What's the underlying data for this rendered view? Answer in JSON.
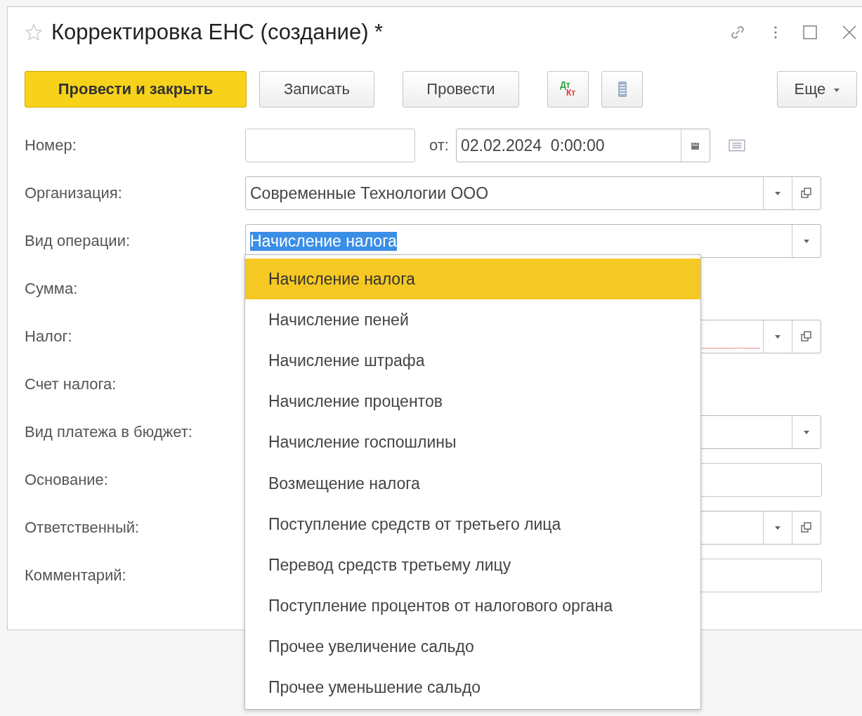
{
  "window": {
    "title": "Корректировка ЕНС (создание) *"
  },
  "toolbar": [
    {
      "kind": "primary",
      "label": "Провести и закрыть"
    },
    {
      "kind": "button",
      "label": "Записать"
    },
    {
      "kind": "button",
      "label": "Провести"
    },
    {
      "kind": "dtkt",
      "top": "Дт",
      "bottom": "Кт"
    },
    {
      "kind": "report"
    },
    {
      "kind": "more",
      "label": "Еще"
    }
  ],
  "fields": [
    {
      "kind": "number",
      "label": "Номер:",
      "date_label": "от:",
      "date": "02.02.2024  0:00:00"
    },
    {
      "kind": "ref",
      "label": "Организация:",
      "value": "Современные Технологии ООО"
    },
    {
      "kind": "select",
      "label": "Вид операции:",
      "value": "Начисление налога",
      "highlighted": true
    },
    {
      "kind": "empty",
      "label": "Сумма:"
    },
    {
      "kind": "ref",
      "label": "Налог:",
      "required": true
    },
    {
      "kind": "empty",
      "label": "Счет налога:"
    },
    {
      "kind": "select",
      "label": "Вид платежа в бюджет:"
    },
    {
      "kind": "input",
      "label": "Основание:"
    },
    {
      "kind": "ref",
      "label": "Ответственный:"
    },
    {
      "kind": "input",
      "label": "Комментарий:"
    }
  ],
  "dropdown": [
    {
      "label": "Начисление налога",
      "selected": true
    },
    {
      "label": "Начисление пеней",
      "selected": false
    },
    {
      "label": "Начисление штрафа",
      "selected": false
    },
    {
      "label": "Начисление процентов",
      "selected": false
    },
    {
      "label": "Начисление госпошлины",
      "selected": false
    },
    {
      "label": "Возмещение налога",
      "selected": false
    },
    {
      "label": "Поступление средств от третьего лица",
      "selected": false
    },
    {
      "label": "Перевод средств третьему лицу",
      "selected": false
    },
    {
      "label": "Поступление процентов от налогового органа",
      "selected": false
    },
    {
      "label": "Прочее увеличение сальдо",
      "selected": false
    },
    {
      "label": "Прочее уменьшение сальдо",
      "selected": false
    }
  ]
}
